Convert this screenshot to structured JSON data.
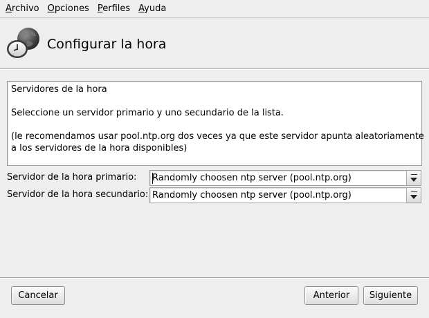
{
  "menubar": {
    "items": [
      {
        "mnemonic": "A",
        "rest": "rchivo"
      },
      {
        "mnemonic": "O",
        "rest": "pciones"
      },
      {
        "mnemonic": "P",
        "rest": "erfiles"
      },
      {
        "mnemonic": "A",
        "rest": "yuda"
      }
    ]
  },
  "header": {
    "title": "Configurar la hora",
    "icon": "clock-icon"
  },
  "info": {
    "line1": "Servidores de la hora",
    "line2": "Seleccione un servidor primario y uno secundario de la lista.",
    "line3": "(le recomendamos usar pool.ntp.org dos veces ya que este servidor apunta aleatoriamente",
    "line4": "a los servidores de la hora disponibles)"
  },
  "form": {
    "primary_label": "Servidor de la hora primario:",
    "primary_value": "Randomly choosen ntp server (pool.ntp.org)",
    "secondary_label": "Servidor de la hora secundario:",
    "secondary_value": "Randomly choosen ntp server (pool.ntp.org)"
  },
  "buttons": {
    "cancel": "Cancelar",
    "previous": "Anterior",
    "next": "Siguiente"
  }
}
